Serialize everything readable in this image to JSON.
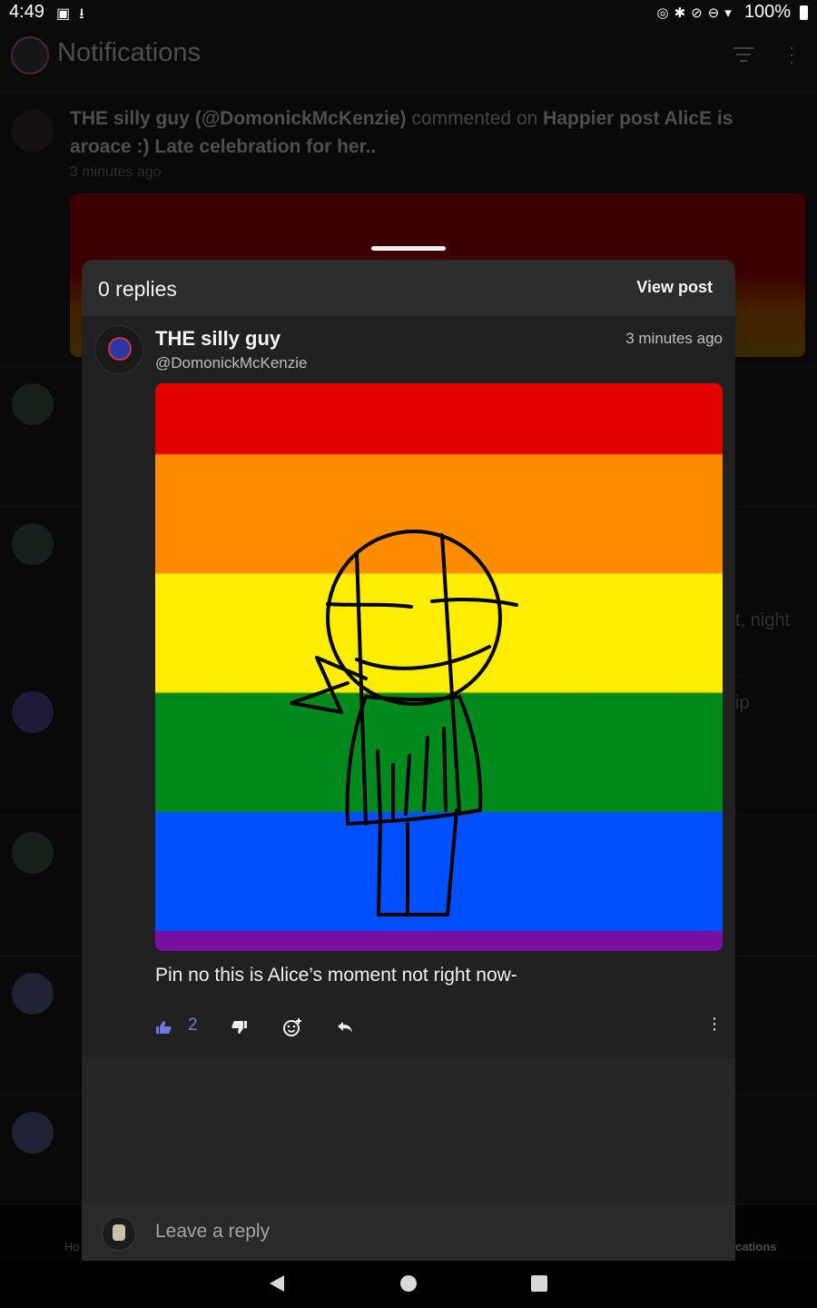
{
  "status_bar": {
    "time": "4:49",
    "battery": "100%"
  },
  "app": {
    "title": "Notifications"
  },
  "notification": {
    "author": "THE silly guy (@DomonickMcKenzie)",
    "action": "commented on",
    "post_title": "Happier post AlicE is aroace :) Late celebration for her..",
    "time": "3 minutes ago"
  },
  "background_fragments": {
    "night_text": "t, night",
    "ip_text": "ip"
  },
  "bottom_nav": {
    "left_label": "Ho",
    "right_label": "cations"
  },
  "sheet": {
    "replies_label": "0 replies",
    "view_post_label": "View post"
  },
  "comment": {
    "author": "THE silly guy",
    "handle": "@DomonickMcKenzie",
    "time": "3 minutes ago",
    "body": "Pin no this is Alice’s moment not right now-",
    "like_count": "2"
  },
  "reply_bar": {
    "placeholder": "Leave a reply"
  },
  "colors": {
    "accent": "#6f79d8",
    "sheet_bg": "#262626",
    "flag_red": "#e20000",
    "flag_orange": "#ff8c00",
    "flag_yellow": "#ffed00",
    "flag_green": "#008a1c",
    "flag_blue": "#0050ff",
    "flag_purple": "#7a10a0"
  },
  "icons": [
    "thumbs-up-icon",
    "thumbs-down-icon",
    "add-reaction-icon",
    "reply-icon",
    "more-vertical-icon",
    "filter-icon"
  ]
}
